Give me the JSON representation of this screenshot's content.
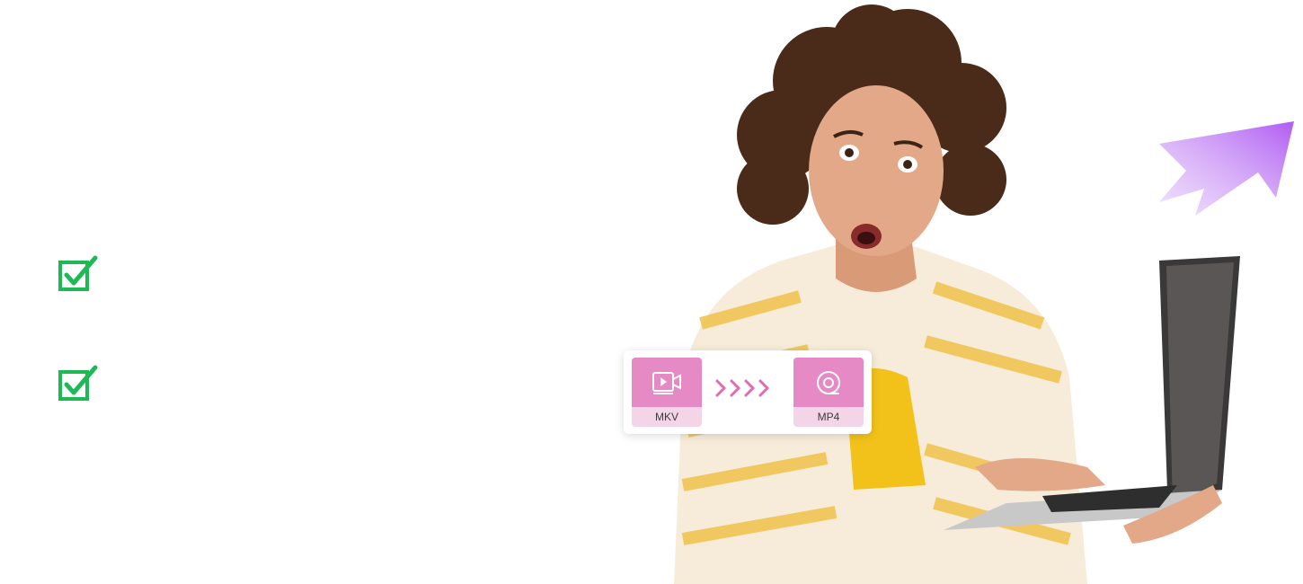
{
  "features": {
    "check_icon_color": "#1db954"
  },
  "converter": {
    "source_format": "MKV",
    "target_format": "MP4",
    "tile_color": "#e58ac4",
    "label_bg_color": "#f4d5e8"
  },
  "accent": {
    "arrow_color": "#b05cf2"
  },
  "icons": {
    "feature_checks": [
      "checkbox-check-icon",
      "checkbox-check-icon"
    ],
    "source": "video-file-icon",
    "target": "disc-icon",
    "transition": "chevrons-right-icon",
    "decor": "purple-arrow-icon"
  }
}
